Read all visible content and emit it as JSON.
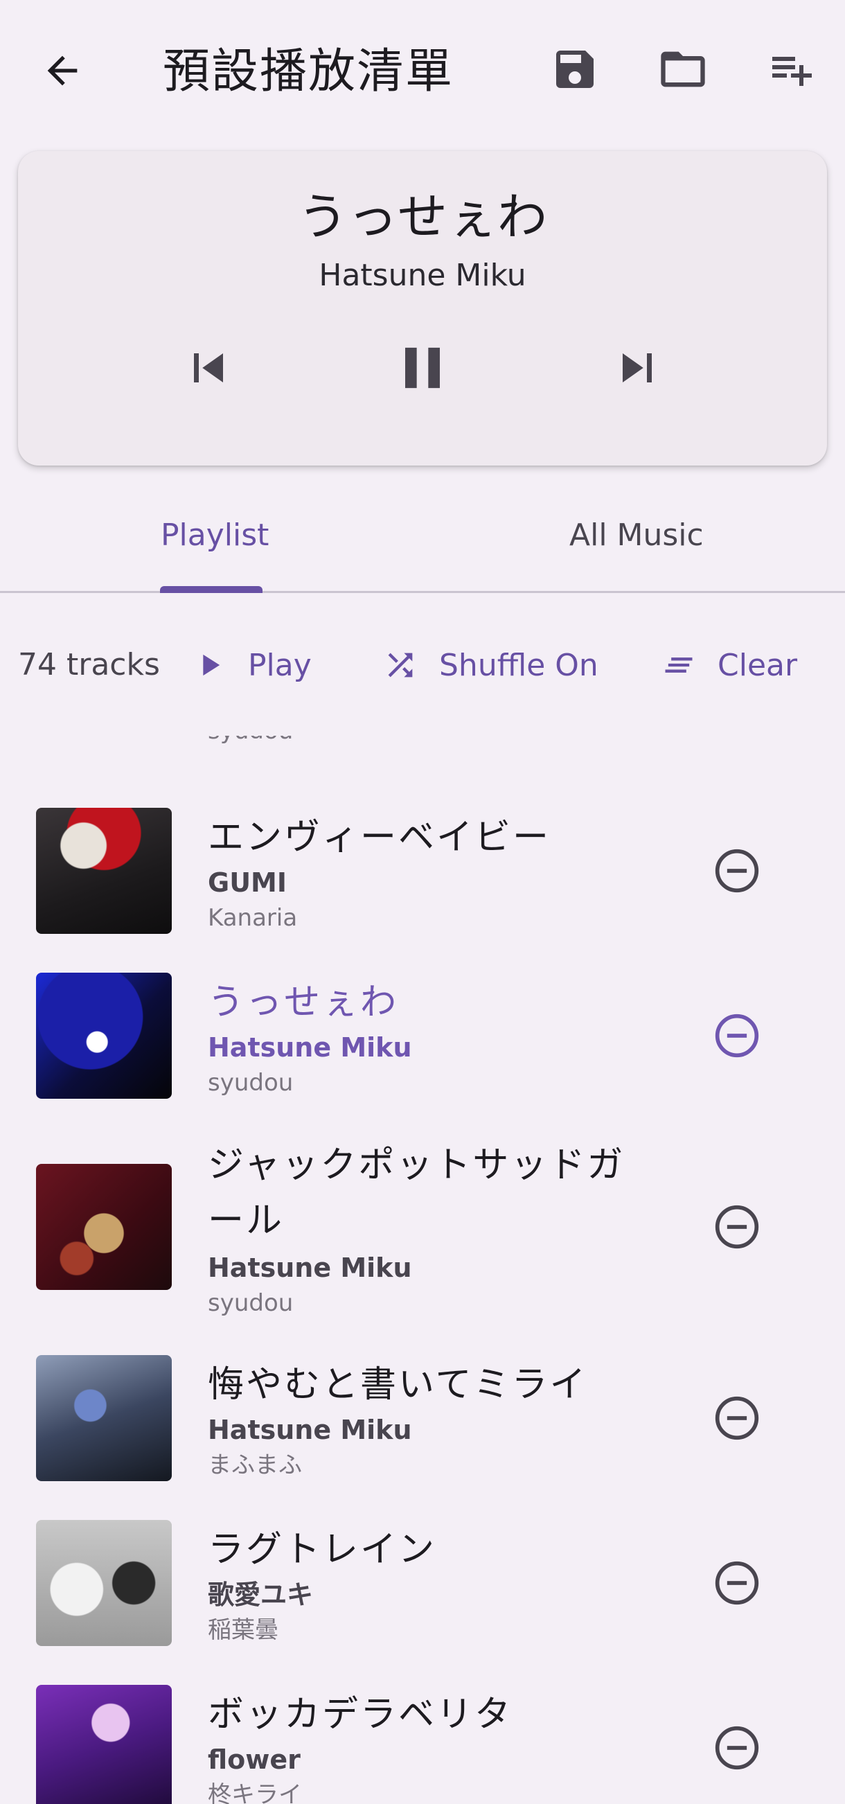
{
  "appbar": {
    "title": "預設播放清單",
    "icons": [
      "arrow-back-icon",
      "save-icon",
      "folder-icon",
      "playlist-add-icon"
    ]
  },
  "now_playing": {
    "title": "うっせぇわ",
    "artist": "Hatsune Miku",
    "state": "playing"
  },
  "tabs": [
    {
      "label": "Playlist",
      "selected": true
    },
    {
      "label": "All Music",
      "selected": false
    }
  ],
  "toolbar": {
    "count": "74 tracks",
    "play_label": "Play",
    "shuffle_label": "Shuffle On",
    "clear_label": "Clear"
  },
  "tracks": [
    {
      "title": "",
      "artist": "",
      "composer": "syudou",
      "partial": true
    },
    {
      "title": "エンヴィーベイビー",
      "artist": "GUMI",
      "composer": "Kanaria"
    },
    {
      "title": "うっせぇわ",
      "artist": "Hatsune Miku",
      "composer": "syudou",
      "active": true
    },
    {
      "title": "ジャックポットサッドガール",
      "artist": "Hatsune Miku",
      "composer": "syudou"
    },
    {
      "title": "悔やむと書いてミライ",
      "artist": "Hatsune Miku",
      "composer": "まふまふ"
    },
    {
      "title": "ラグトレイン",
      "artist": "歌愛ユキ",
      "composer": "稲葉曇"
    },
    {
      "title": "ボッカデラベリタ",
      "artist": "flower",
      "composer": "柊キライ"
    }
  ],
  "colors": {
    "background": "#f4eff6",
    "accent": "#6750a4",
    "card": "#efe9ef",
    "icon": "#49454f"
  }
}
